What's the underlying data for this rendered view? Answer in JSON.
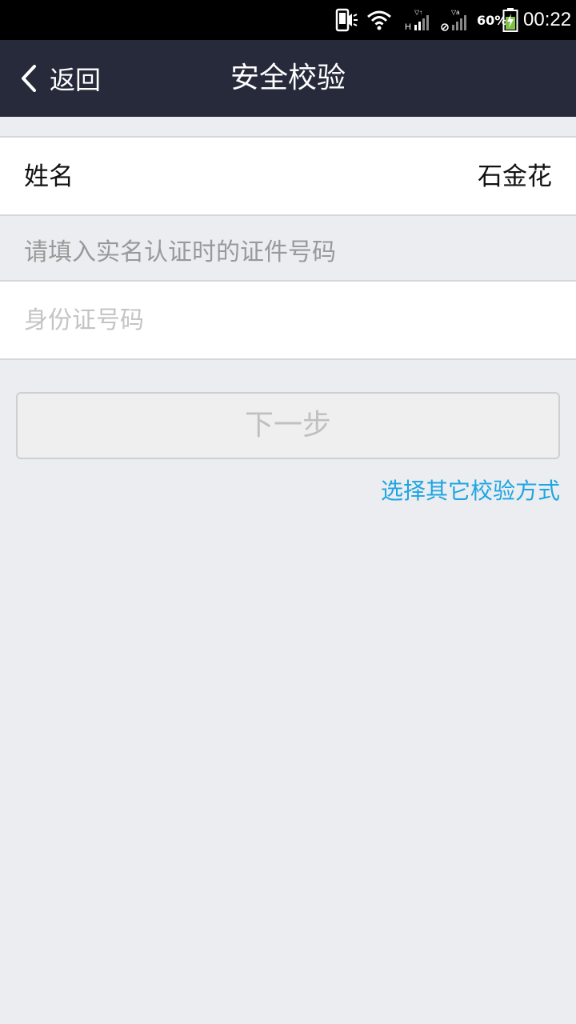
{
  "status_bar": {
    "battery_percent": "60%",
    "time": "00:22",
    "icons": [
      "phone-vibrate-icon",
      "wifi-icon",
      "signal-h-icon",
      "signal-no-sim-icon",
      "battery-charging-icon"
    ]
  },
  "nav": {
    "back_label": "返回",
    "title": "安全校验"
  },
  "form": {
    "name_label": "姓名",
    "name_value": "石金花",
    "hint": "请填入实名认证时的证件号码",
    "id_placeholder": "身份证号码",
    "id_value": ""
  },
  "actions": {
    "next_label": "下一步",
    "other_method_label": "选择其它校验方式"
  },
  "colors": {
    "nav_bg": "#262a3a",
    "page_bg": "#ebedf0",
    "link": "#1ea5e3"
  }
}
